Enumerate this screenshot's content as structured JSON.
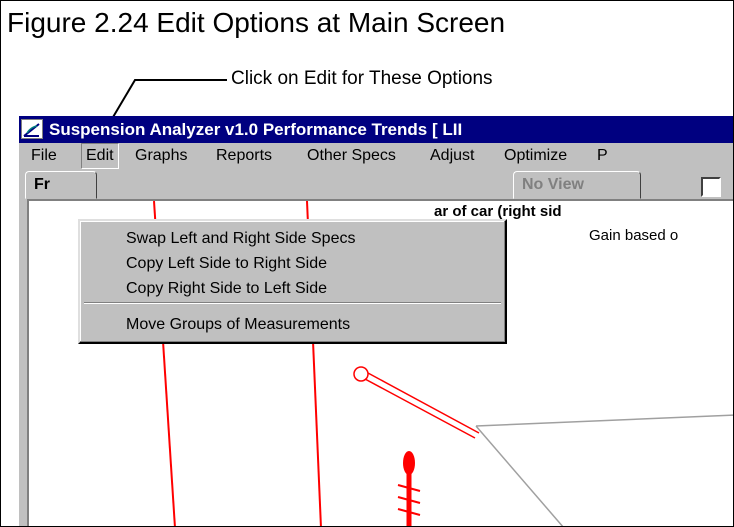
{
  "figure": {
    "title": "Figure 2.24 Edit Options at Main Screen",
    "callout": "Click on Edit for These Options"
  },
  "window": {
    "title": "Suspension Analyzer v1.0   Performance Trends   [ LII"
  },
  "menubar": {
    "items": [
      {
        "label": "File"
      },
      {
        "label": "Edit"
      },
      {
        "label": "Graphs"
      },
      {
        "label": "Reports"
      },
      {
        "label": "Other Specs"
      },
      {
        "label": "Adjust"
      },
      {
        "label": "Optimize"
      },
      {
        "label": "P"
      }
    ]
  },
  "edit_menu": {
    "items": [
      {
        "label": "Swap Left and Right Side Specs"
      },
      {
        "label": "Copy Left Side to Right Side"
      },
      {
        "label": "Copy Right Side to Left Side"
      },
      {
        "label": "Move Groups of Measurements"
      }
    ]
  },
  "tabs": [
    {
      "label": "Fr"
    },
    {
      "label": "No View"
    }
  ],
  "canvas": {
    "header": "ar of car (right sid",
    "subheader": "Gain based o"
  },
  "colors": {
    "titlebar": "#000080",
    "window": "#c0c0c0",
    "graph_line": "#ff0000",
    "graph_frame": "#a0a0a0"
  },
  "icons": {
    "app": "suspension-app-icon"
  }
}
